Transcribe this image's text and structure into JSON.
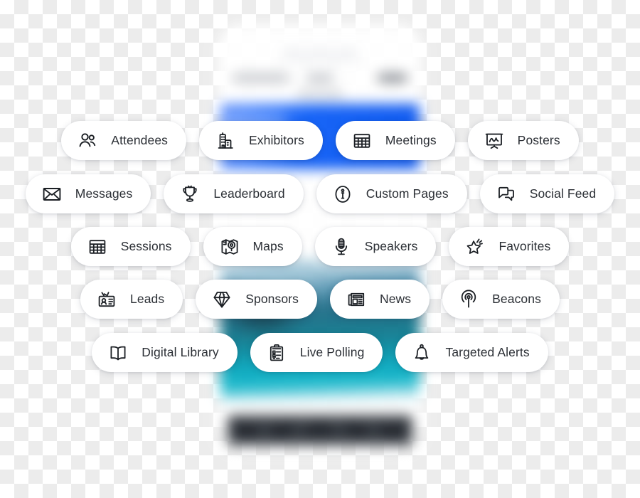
{
  "background": {
    "description": "blurred event-app phone mockup",
    "hero_color": "#0b57f0",
    "photo_color": "#09a7bd",
    "tabbar_color": "#33383f"
  },
  "menu": {
    "rows": [
      {
        "items": [
          {
            "label": "Attendees",
            "icon": "people-icon"
          },
          {
            "label": "Exhibitors",
            "icon": "building-icon"
          },
          {
            "label": "Meetings",
            "icon": "grid-table-icon"
          },
          {
            "label": "Posters",
            "icon": "presentation-board-icon"
          }
        ]
      },
      {
        "items": [
          {
            "label": "Messages",
            "icon": "envelope-icon"
          },
          {
            "label": "Leaderboard",
            "icon": "trophy-icon"
          },
          {
            "label": "Custom Pages",
            "icon": "info-circle-icon"
          },
          {
            "label": "Social Feed",
            "icon": "chat-bubbles-icon"
          }
        ]
      },
      {
        "items": [
          {
            "label": "Sessions",
            "icon": "grid-table-icon"
          },
          {
            "label": "Maps",
            "icon": "map-pin-icon"
          },
          {
            "label": "Speakers",
            "icon": "microphone-icon"
          },
          {
            "label": "Favorites",
            "icon": "star-sparkle-icon"
          }
        ]
      },
      {
        "items": [
          {
            "label": "Leads",
            "icon": "id-badge-icon"
          },
          {
            "label": "Sponsors",
            "icon": "diamond-icon"
          },
          {
            "label": "News",
            "icon": "newspaper-icon"
          },
          {
            "label": "Beacons",
            "icon": "beacon-signal-icon"
          }
        ]
      },
      {
        "items": [
          {
            "label": "Digital Library",
            "icon": "open-book-icon"
          },
          {
            "label": "Live Polling",
            "icon": "clipboard-checklist-icon"
          },
          {
            "label": "Targeted Alerts",
            "icon": "bell-icon"
          }
        ]
      }
    ]
  },
  "colors": {
    "pill_background": "#ffffff",
    "label_text": "#2b2f35",
    "icon_stroke": "#1b1f24",
    "checkerboard_light": "#ffffff",
    "checkerboard_dark": "#ececec"
  }
}
